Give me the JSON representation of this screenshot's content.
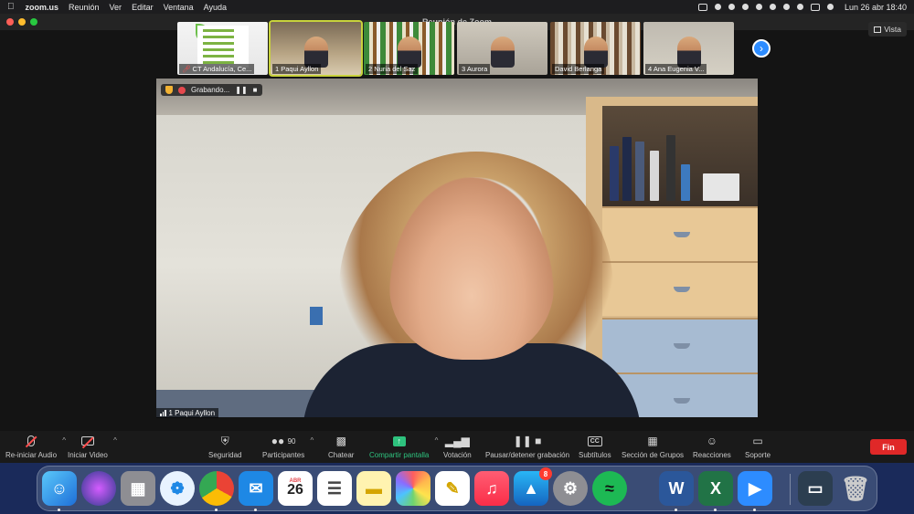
{
  "menubar": {
    "app_name": "zoom.us",
    "items": [
      "Reunión",
      "Ver",
      "Editar",
      "Ventana",
      "Ayuda"
    ],
    "datetime": "Lun 26 abr  18:40"
  },
  "window": {
    "title": "Reunión de Zoom"
  },
  "view_button": "Vista",
  "thumbnails": [
    {
      "name": "CT Andalucía, Ce...",
      "muted": true
    },
    {
      "name": "1 Paqui Ayllon",
      "muted": false
    },
    {
      "name": "2 Nuria del Saz",
      "muted": false
    },
    {
      "name": "3 Aurora",
      "muted": false
    },
    {
      "name": "David Berlanga",
      "muted": false
    },
    {
      "name": "4 Ana Eugenia V...",
      "muted": false
    }
  ],
  "recording": {
    "label": "Grabando..."
  },
  "speaker_label": "1 Paqui Ayllon",
  "toolbar": {
    "mic": "Re-iniciar Audio",
    "video": "Iniciar Video",
    "security": "Seguridad",
    "participants": "Participantes",
    "participants_count": "90",
    "chat": "Chatear",
    "share": "Compartir pantalla",
    "poll": "Votación",
    "record": "Pausar/detener grabación",
    "subtitles": "Subtítulos",
    "breakout": "Sección de Grupos",
    "reactions": "Reacciones",
    "support": "Soporte",
    "end": "Fin",
    "cc": "CC"
  },
  "dock": {
    "calendar_month": "ABR",
    "calendar_day": "26",
    "appstore_badge": "8",
    "word_letter": "W",
    "excel_letter": "X"
  },
  "colors": {
    "accent_blue": "#2d8cff",
    "share_green": "#2ec27e",
    "end_red": "#e02828"
  }
}
